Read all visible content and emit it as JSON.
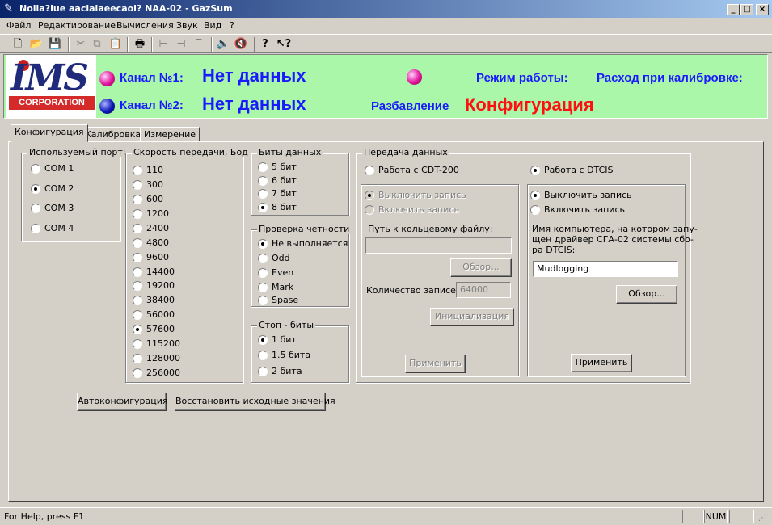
{
  "window": {
    "title": "Noiia?iue aaciaiaeecaoi? NAA-02 - GazSum"
  },
  "menu": [
    "Файл",
    "Редактирование",
    "Вычисления",
    "Звук",
    "Вид",
    "?"
  ],
  "banner": {
    "logo_text": "IMS",
    "logo_sub": "CORPORATION",
    "channel1_label": "Канал №1:",
    "channel1_value": "Нет данных",
    "channel2_label": "Канал №2:",
    "channel2_value": "Нет данных",
    "mode_label": "Режим работы:",
    "calib_flow_label": "Расход при калибровке:",
    "dilution_label": "Разбавление",
    "mode_value": "Конфигурация"
  },
  "tabs": [
    "Конфигурация",
    "Калибровка",
    "Измерение"
  ],
  "port_group": {
    "caption": "Используемый порт:",
    "options": [
      "COM 1",
      "COM 2",
      "COM 3",
      "COM 4"
    ],
    "selected": 1
  },
  "speed_group": {
    "caption": "Скорость передачи, Бод",
    "options": [
      "110",
      "300",
      "600",
      "1200",
      "2400",
      "4800",
      "9600",
      "14400",
      "19200",
      "38400",
      "56000",
      "57600",
      "115200",
      "128000",
      "256000"
    ],
    "selected": 11
  },
  "data_bits_group": {
    "caption": "Биты данных",
    "options": [
      "5 бит",
      "6 бит",
      "7 бит",
      "8 бит"
    ],
    "selected": 3
  },
  "parity_group": {
    "caption": "Проверка четности",
    "options": [
      "Не выполняется",
      "Odd",
      "Even",
      "Mark",
      "Spase"
    ],
    "selected": 0
  },
  "stop_bits_group": {
    "caption": "Стоп - биты",
    "options": [
      "1 бит",
      "1.5 бита",
      "2 бита"
    ],
    "selected": 0
  },
  "transfer_group": {
    "caption": "Передача данных",
    "cdt_radio": "Работа с CDT-200",
    "dtcis_radio": "Работа с DTCIS",
    "left": {
      "disable_rec": "Выключить запись",
      "enable_rec": "Включить запись",
      "path_label": "Путь к кольцевому файлу:",
      "path_value": "",
      "browse": "Обзор...",
      "count_label": "Количество записей:",
      "count_value": "64000",
      "init": "Инициализация",
      "apply": "Применить"
    },
    "right": {
      "disable_rec": "Выключить запись",
      "enable_rec": "Включить запись",
      "computer_label_1": "Имя компьютера, на котором запу-",
      "computer_label_2": "щен драйвер СГА-02 системы сбо-",
      "computer_label_3": "ра DTCIS:",
      "computer_value": "Mudlogging",
      "browse": "Обзор...",
      "apply": "Применить"
    }
  },
  "buttons": {
    "autoconfig": "Автоконфигурация",
    "restore": "Восстановить исходные значения"
  },
  "statusbar": {
    "help": "For Help, press F1",
    "num": "NUM"
  }
}
